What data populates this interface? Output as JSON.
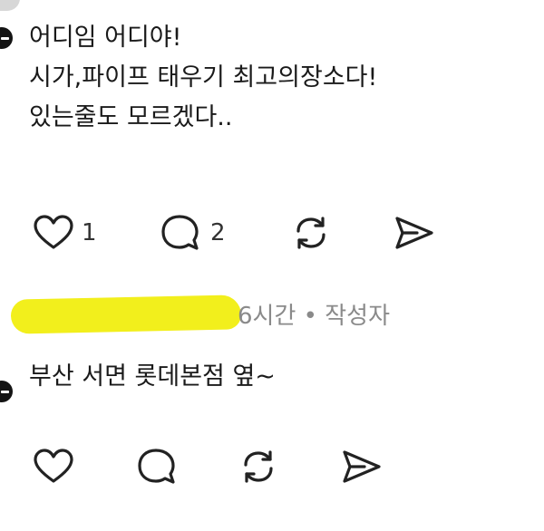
{
  "post": {
    "lines": [
      "어디임 어디야!",
      "시가,파이프 태우기 최고의장소다!",
      "있는줄도 모르겠다.."
    ],
    "likes": "1",
    "replies": "2"
  },
  "reply": {
    "meta": "6시간 • 작성자",
    "text": "부산 서면 롯데본점 옆~"
  },
  "icons": {
    "like": "heart-icon",
    "comment": "comment-bubble-icon",
    "repost": "repost-icon",
    "share": "send-icon",
    "badge": "minus-circle-icon"
  }
}
